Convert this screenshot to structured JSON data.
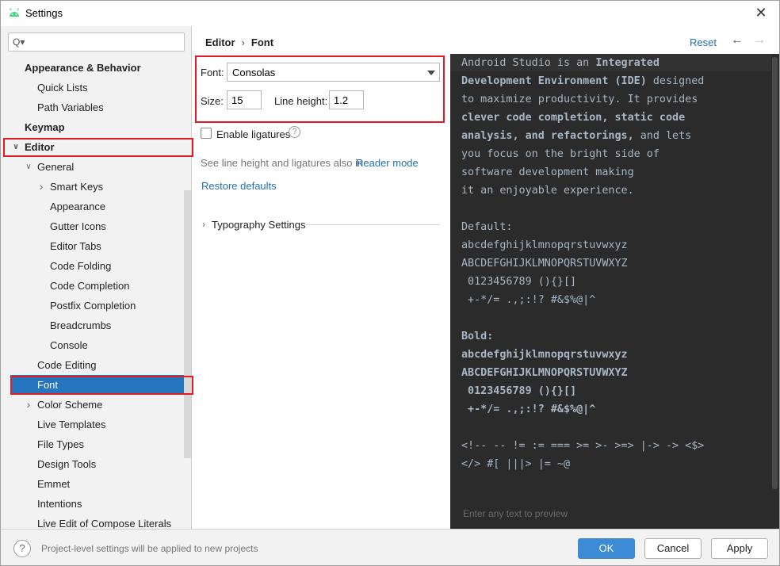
{
  "window": {
    "title": "Settings",
    "close_glyph": "✕"
  },
  "search": {
    "placeholder": "Q▾",
    "icon": "search-icon"
  },
  "tree": [
    {
      "label": "Appearance & Behavior",
      "bold": true,
      "level": 0
    },
    {
      "label": "Quick Lists",
      "level": 1
    },
    {
      "label": "Path Variables",
      "level": 1
    },
    {
      "label": "Keymap",
      "bold": true,
      "level": 0
    },
    {
      "label": "Editor",
      "bold": true,
      "level": 0,
      "expanded": true
    },
    {
      "label": "General",
      "level": 1,
      "expanded": true
    },
    {
      "label": "Smart Keys",
      "level": 2,
      "collapsed": true
    },
    {
      "label": "Appearance",
      "level": 2
    },
    {
      "label": "Gutter Icons",
      "level": 2
    },
    {
      "label": "Editor Tabs",
      "level": 2
    },
    {
      "label": "Code Folding",
      "level": 2
    },
    {
      "label": "Code Completion",
      "level": 2
    },
    {
      "label": "Postfix Completion",
      "level": 2
    },
    {
      "label": "Breadcrumbs",
      "level": 2
    },
    {
      "label": "Console",
      "level": 2
    },
    {
      "label": "Code Editing",
      "level": 1
    },
    {
      "label": "Font",
      "level": 1,
      "selected": true
    },
    {
      "label": "Color Scheme",
      "level": 1,
      "collapsed": true
    },
    {
      "label": "Live Templates",
      "level": 1
    },
    {
      "label": "File Types",
      "level": 1
    },
    {
      "label": "Design Tools",
      "level": 1
    },
    {
      "label": "Emmet",
      "level": 1
    },
    {
      "label": "Intentions",
      "level": 1
    },
    {
      "label": "Live Edit of Compose Literals",
      "level": 1
    }
  ],
  "breadcrumb": {
    "first": "Editor",
    "separator": "›",
    "second": "Font"
  },
  "toolbar": {
    "reset": "Reset",
    "back": "←",
    "forward": "→"
  },
  "font": {
    "font_label": "Font:",
    "font_value": "Consolas",
    "size_label": "Size:",
    "size_value": "15",
    "line_height_label": "Line height:",
    "line_height_value": "1.2",
    "ligatures_label": "Enable ligatures",
    "ligatures_checked": false,
    "help_glyph": "?",
    "see_also_text": "See line height and ligatures also in",
    "reader_mode_link": "Reader mode",
    "restore_defaults": "Restore defaults",
    "typography_settings": "Typography Settings"
  },
  "preview": {
    "lines": [
      {
        "text": "Android Studio is an Integrated",
        "bold": false
      },
      {
        "text": "Development Environment (IDE) designed",
        "bold": false
      },
      {
        "text": "to maximize productivity. It provides",
        "bold": false
      },
      {
        "text": "clever code completion, static code",
        "bold": true
      },
      {
        "text": "analysis, and refactorings, and lets",
        "bold": false
      },
      {
        "text": "you focus on the bright side of",
        "bold": false
      },
      {
        "text": "software development making",
        "bold": false
      },
      {
        "text": "it an enjoyable experience.",
        "bold": false
      },
      {
        "text": "",
        "bold": false
      },
      {
        "text": "Default:",
        "bold": false
      },
      {
        "text": "abcdefghijklmnopqrstuvwxyz",
        "bold": false
      },
      {
        "text": "ABCDEFGHIJKLMNOPQRSTUVWXYZ",
        "bold": false
      },
      {
        "text": " 0123456789 (){}[]",
        "bold": false
      },
      {
        "text": " +-*/= .,;:!? #&$%@|^",
        "bold": false
      },
      {
        "text": "",
        "bold": false
      },
      {
        "text": "Bold:",
        "bold": true
      },
      {
        "text": "abcdefghijklmnopqrstuvwxyz",
        "bold": true
      },
      {
        "text": "ABCDEFGHIJKLMNOPQRSTUVWXYZ",
        "bold": true
      },
      {
        "text": " 0123456789 (){}[]",
        "bold": true
      },
      {
        "text": " +-*/= .,;:!? #&$%@|^",
        "bold": true
      },
      {
        "text": "",
        "bold": false
      },
      {
        "text": "<!-- -- != := === >= >- >=> |-> -> <$>",
        "bold": false
      },
      {
        "text": "</> #[ |||> |= ~@",
        "bold": false
      }
    ],
    "placeholder": "Enter any text to preview"
  },
  "footer": {
    "help_glyph": "?",
    "note": "Project-level settings will be applied to new projects",
    "ok": "OK",
    "cancel": "Cancel",
    "apply": "Apply"
  },
  "colors": {
    "selection": "#2675bf",
    "highlight_box": "#e31b23",
    "link": "#2470b3",
    "preview_bg": "#2b2b2b",
    "preview_text": "#a9b7c6",
    "primary_button": "#3d8ad6"
  }
}
